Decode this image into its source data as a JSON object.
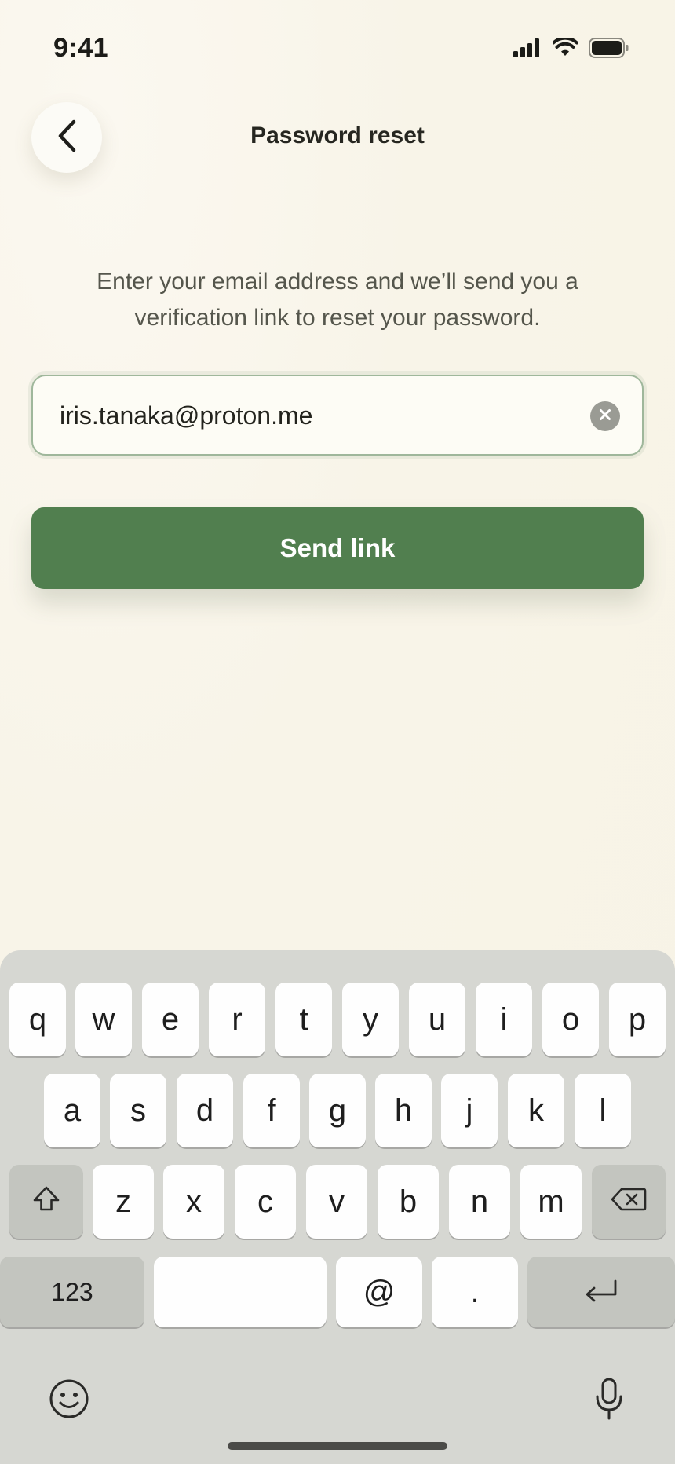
{
  "status": {
    "time": "9:41"
  },
  "nav": {
    "title": "Password reset"
  },
  "description": "Enter your email address and we’ll send you a verification link to reset your password.",
  "email": {
    "value": "iris.tanaka@proton.me"
  },
  "send_button": {
    "label": "Send link"
  },
  "colors": {
    "accent": "#517f4f",
    "background": "#f8f4e9",
    "field_border": "#9fb79b"
  },
  "keyboard": {
    "row1": [
      "q",
      "w",
      "e",
      "r",
      "t",
      "y",
      "u",
      "i",
      "o",
      "p"
    ],
    "row2": [
      "a",
      "s",
      "d",
      "f",
      "g",
      "h",
      "j",
      "k",
      "l"
    ],
    "row3": [
      "z",
      "x",
      "c",
      "v",
      "b",
      "n",
      "m"
    ],
    "numbers_label": "123",
    "at_label": "@",
    "dot_label": ".",
    "icons": [
      "shift-icon",
      "backspace-icon",
      "return-icon",
      "emoji-icon",
      "microphone-icon"
    ]
  }
}
